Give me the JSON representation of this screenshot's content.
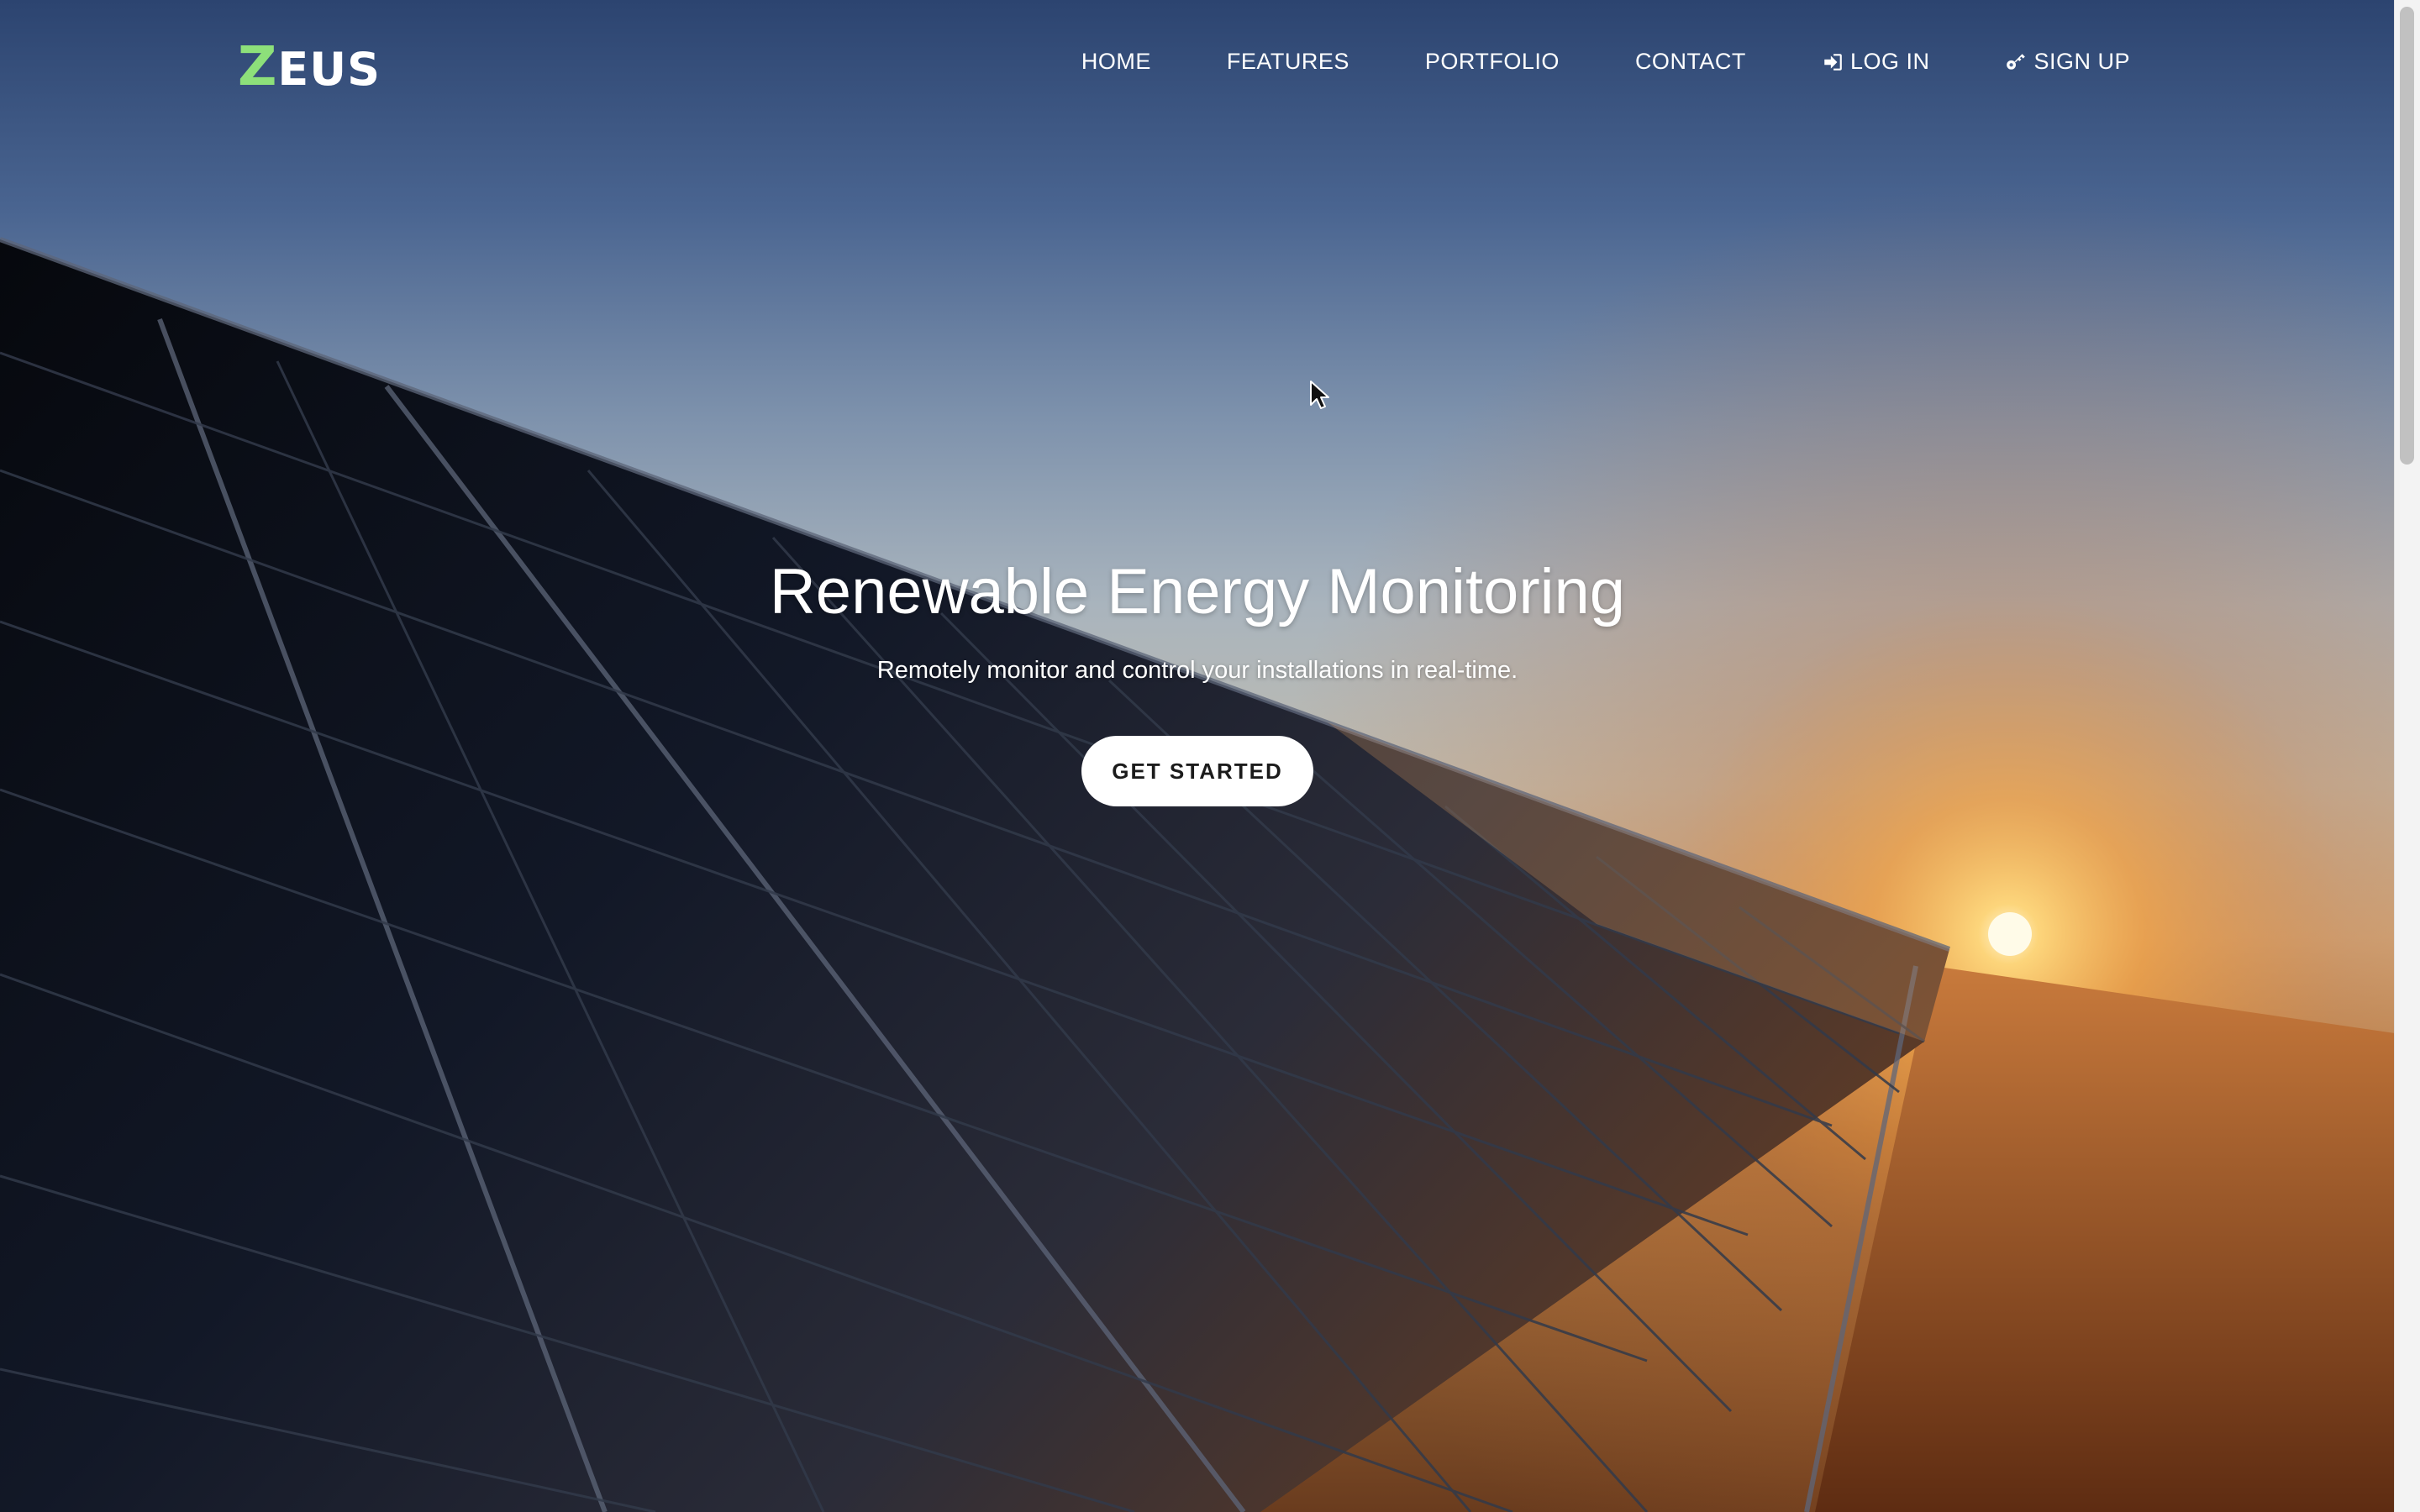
{
  "brand": {
    "logo_initial": "Z",
    "logo_rest": "EUS",
    "logo_accent_color": "#8de07a"
  },
  "nav": {
    "items": [
      {
        "label": "HOME"
      },
      {
        "label": "FEATURES"
      },
      {
        "label": "PORTFOLIO"
      },
      {
        "label": "CONTACT"
      },
      {
        "label": "LOG IN",
        "icon": "sign-in-icon"
      },
      {
        "label": "SIGN UP",
        "icon": "key-icon"
      }
    ]
  },
  "hero": {
    "title": "Renewable Energy Monitoring",
    "subtitle": "Remotely monitor and control your installations in real-time.",
    "cta_label": "GET STARTED",
    "background": "solar-panels-sunset-image"
  },
  "colors": {
    "text": "#ffffff",
    "button_bg": "#ffffff",
    "button_text": "#1b1b1b"
  }
}
